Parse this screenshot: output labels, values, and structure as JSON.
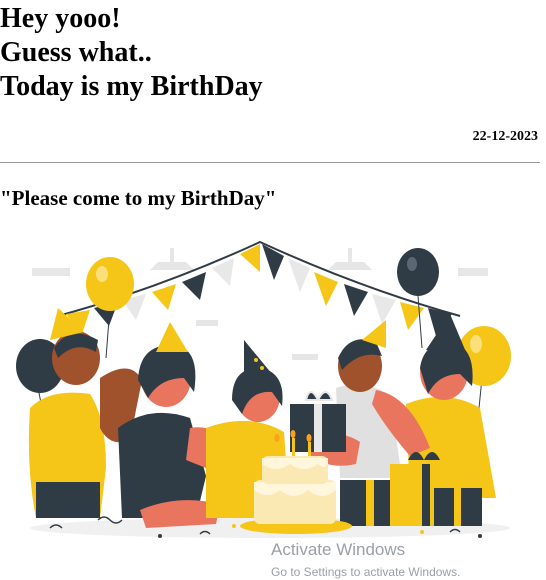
{
  "headline": {
    "line1": "Hey yooo!",
    "line2": "Guess what..",
    "line3": "Today is my BirthDay"
  },
  "date": "22-12-2023",
  "invite": "\"Please come to my BirthDay\"",
  "illustration": {
    "icon": "birthday-party-illustration",
    "colors": {
      "yellow": "#f5c518",
      "skin": "#e9755f",
      "dark": "#2f3b45"
    }
  },
  "watermark": {
    "title": "Activate Windows",
    "subtitle": "Go to Settings to activate Windows."
  }
}
